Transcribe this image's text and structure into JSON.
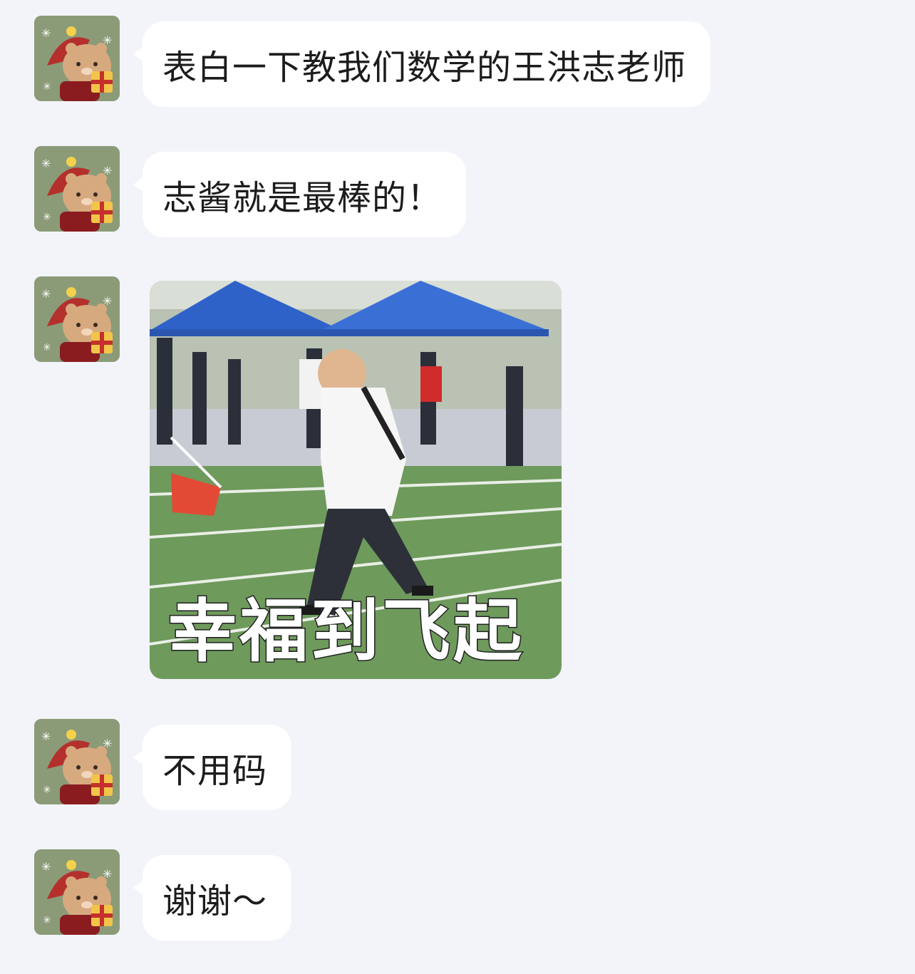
{
  "messages": [
    {
      "type": "text",
      "text": "表白一下教我们数学的王洪志老师"
    },
    {
      "type": "text",
      "text": "志酱就是最棒的！"
    },
    {
      "type": "image",
      "caption": "幸福到飞起"
    },
    {
      "type": "text",
      "text": "不用码"
    },
    {
      "type": "text",
      "text": "谢谢～"
    }
  ],
  "colors": {
    "background": "#f3f4f9",
    "bubble": "#ffffff",
    "avatar_bg": "#8b9b78"
  },
  "icons": {
    "avatar": "bear-christmas-hat-avatar-icon"
  }
}
